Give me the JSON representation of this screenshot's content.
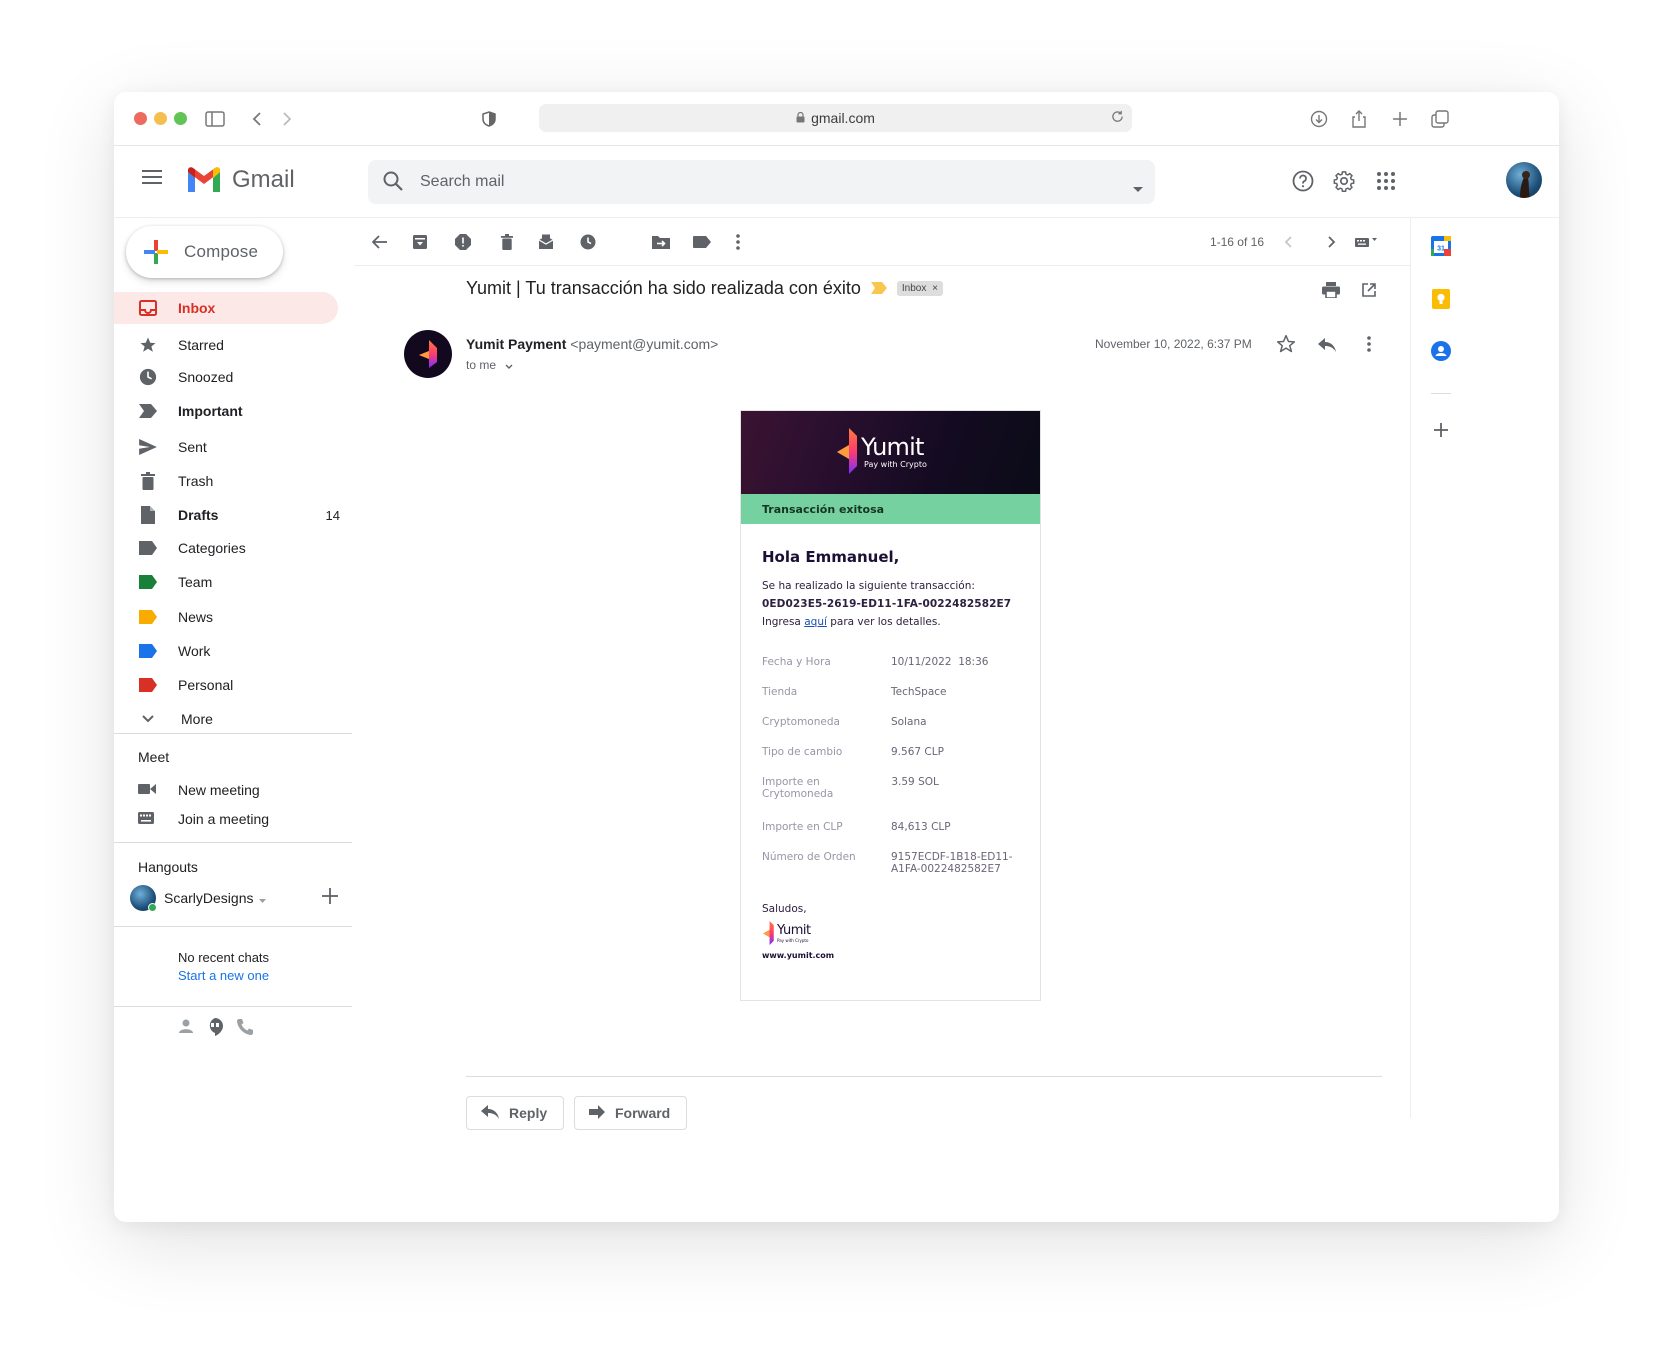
{
  "browser": {
    "url": "gmail.com"
  },
  "header": {
    "app_name": "Gmail",
    "search_placeholder": "Search mail"
  },
  "sidebar": {
    "compose_label": "Compose",
    "items": [
      {
        "label": "Inbox",
        "icon": "inbox-icon"
      },
      {
        "label": "Starred",
        "icon": "star-icon"
      },
      {
        "label": "Snoozed",
        "icon": "clock-icon"
      },
      {
        "label": "Important",
        "icon": "important-icon"
      },
      {
        "label": "Sent",
        "icon": "send-icon"
      },
      {
        "label": "Trash",
        "icon": "trash-icon"
      },
      {
        "label": "Drafts",
        "icon": "draft-icon",
        "count": "14"
      },
      {
        "label": "Categories",
        "icon": "label-icon"
      },
      {
        "label": "Team",
        "icon": "label-icon",
        "color": "#188038"
      },
      {
        "label": "News",
        "icon": "label-icon",
        "color": "#f9ab00"
      },
      {
        "label": "Work",
        "icon": "label-icon",
        "color": "#1a73e8"
      },
      {
        "label": "Personal",
        "icon": "label-icon",
        "color": "#d93025"
      },
      {
        "label": "More",
        "icon": "chevron-down-icon"
      }
    ],
    "meet": {
      "title": "Meet",
      "new_meeting": "New meeting",
      "join_meeting": "Join a meeting"
    },
    "hangouts": {
      "title": "Hangouts",
      "user": "ScarlyDesigns",
      "no_chats": "No recent chats",
      "start_new": "Start a new one"
    }
  },
  "toolbar": {
    "pager": "1-16 of 16"
  },
  "email": {
    "subject": "Yumit | Tu transacción ha sido realizada con éxito",
    "label_chip": "Inbox",
    "chip_close": "×",
    "sender_name": "Yumit Payment",
    "sender_email": "<payment@yumit.com>",
    "to": "to me",
    "date": "November 10, 2022, 6:37 PM",
    "body": {
      "brand": "Yumit",
      "tagline": "Pay with Crypto",
      "status_bar": "Transacción exitosa",
      "greeting": "Hola Emmanuel,",
      "intro": "Se ha realizado la siguiente transacción:",
      "transaction_id": "0ED023E5-2619-ED11-1FA-0022482582E7",
      "details_prefix": "Ingresa ",
      "details_link": "aquí",
      "details_suffix": " para ver los detalles.",
      "rows": [
        {
          "k": "Fecha y Hora",
          "v": "10/11/2022  18:36"
        },
        {
          "k": "Tienda",
          "v": "TechSpace"
        },
        {
          "k": "Cryptomoneda",
          "v": "Solana"
        },
        {
          "k": "Tipo de cambio",
          "v": "9.567 CLP"
        },
        {
          "k": "Importe en Crytomoneda",
          "v": "3.59 SOL"
        },
        {
          "k": "Importe en CLP",
          "v": "84,613 CLP"
        },
        {
          "k": "Número de Orden",
          "v": "9157ECDF-1B18-ED11-A1FA-0022482582E7"
        }
      ],
      "signoff": "Saludos,",
      "website": "www.yumit.com"
    }
  },
  "actions": {
    "reply": "Reply",
    "forward": "Forward"
  },
  "colors": {
    "accent_red": "#d93025",
    "status_green": "#76d1a1",
    "brand_dark": "#12091f"
  }
}
